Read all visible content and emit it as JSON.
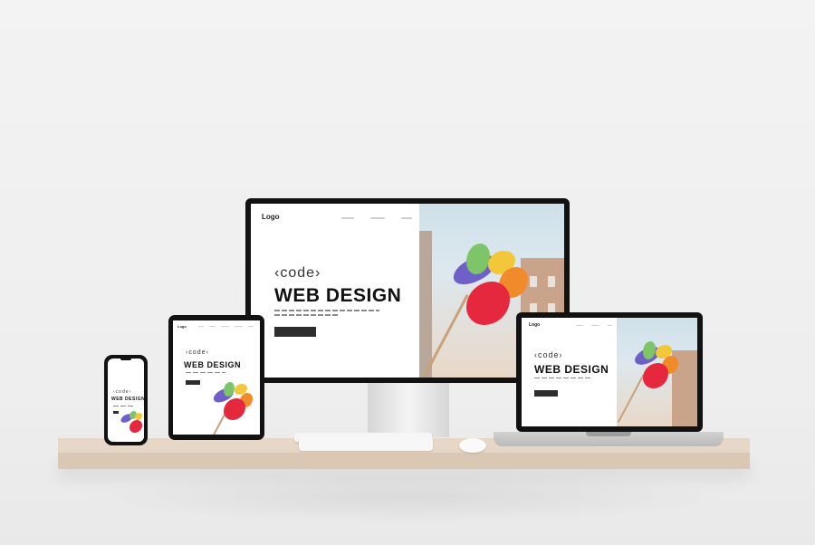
{
  "scene": {
    "devices": [
      "monitor",
      "laptop",
      "tablet",
      "phone"
    ],
    "accents": {
      "wall": "#efefef",
      "shelf": "#e2d1bf",
      "bezel": "#121212",
      "pinwheel_red": "#e5283d",
      "pinwheel_purple": "#6f5fc8",
      "pinwheel_yellow": "#f2c73a",
      "pinwheel_green": "#7ec56a",
      "pinwheel_orange": "#f18a2b"
    }
  },
  "website": {
    "logo": "Logo",
    "kicker": "‹code›",
    "title": "WEB DESIGN",
    "nav_items": 5
  }
}
